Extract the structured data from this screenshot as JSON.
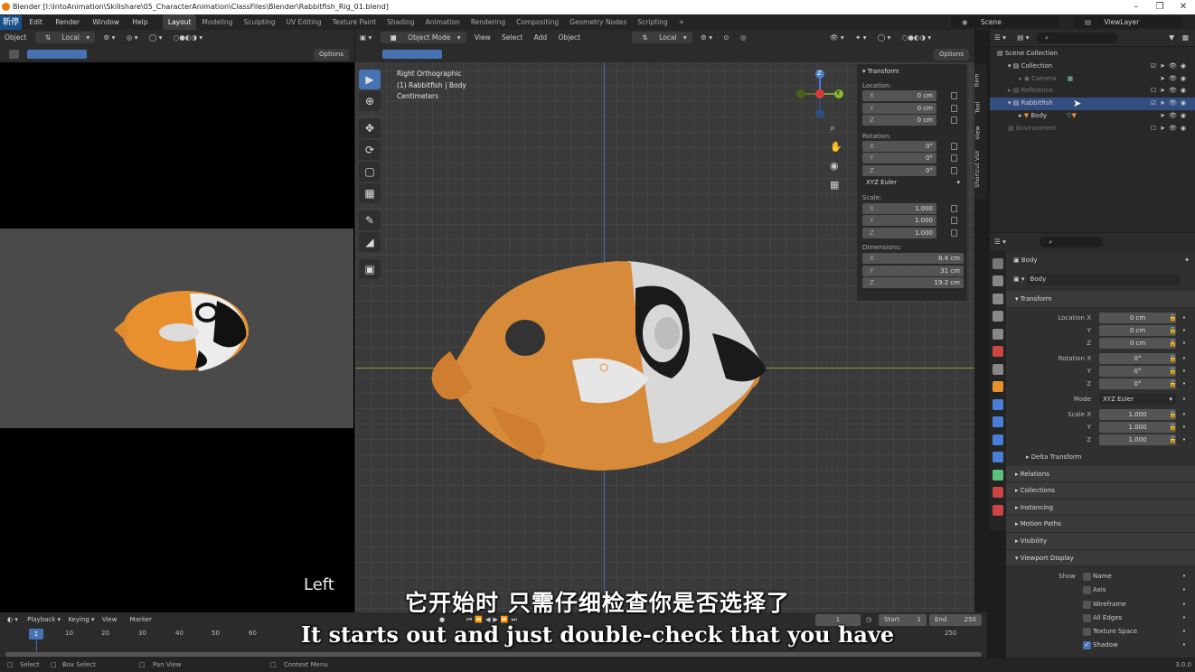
{
  "window": {
    "title": "Blender [I:\\IntoAnimation\\Skillshare\\05_CharacterAnimation\\ClassFiles\\Blender\\Rabbitfish_Rig_01.blend]",
    "watermark": "新停"
  },
  "menu": [
    "Edit",
    "Render",
    "Window",
    "Help"
  ],
  "workspaces": [
    "Layout",
    "Modeling",
    "Sculpting",
    "UV Editing",
    "Texture Paint",
    "Shading",
    "Animation",
    "Rendering",
    "Compositing",
    "Geometry Nodes",
    "Scripting",
    "+"
  ],
  "active_workspace": "Layout",
  "scene": "Scene",
  "view_layer": "ViewLayer",
  "left_header": {
    "mode": "Object",
    "orientation": "Local",
    "options": "Options"
  },
  "left_view": {
    "label": "Left"
  },
  "viewport_header": {
    "mode": "Object Mode",
    "menus": [
      "View",
      "Select",
      "Add",
      "Object"
    ],
    "orientation": "Local",
    "options": "Options"
  },
  "viewport_info": {
    "line1": "Right Orthographic",
    "line2": "(1) Rabbitfish | Body",
    "line3": "Centimeters"
  },
  "npanel": {
    "title": "Transform",
    "location_label": "Location:",
    "location": [
      {
        "axis": "X",
        "value": "0 cm"
      },
      {
        "axis": "Y",
        "value": "0 cm"
      },
      {
        "axis": "Z",
        "value": "0 cm"
      }
    ],
    "rotation_label": "Rotation:",
    "rotation": [
      {
        "axis": "X",
        "value": "0°"
      },
      {
        "axis": "Y",
        "value": "0°"
      },
      {
        "axis": "Z",
        "value": "0°"
      }
    ],
    "rotation_mode": "XYZ Euler",
    "scale_label": "Scale:",
    "scale": [
      {
        "axis": "X",
        "value": "1.000"
      },
      {
        "axis": "Y",
        "value": "1.000"
      },
      {
        "axis": "Z",
        "value": "1.000"
      }
    ],
    "dimensions_label": "Dimensions:",
    "dimensions": [
      {
        "axis": "X",
        "value": "8.4 cm"
      },
      {
        "axis": "Y",
        "value": "31 cm"
      },
      {
        "axis": "Z",
        "value": "19.2 cm"
      }
    ],
    "side_tabs": [
      "Item",
      "Tool",
      "View",
      "Shortcut VUr"
    ]
  },
  "gizmo": {
    "z": "Z",
    "y": "Y"
  },
  "outliner": {
    "rows": [
      {
        "label": "Scene Collection"
      },
      {
        "label": "Collection"
      },
      {
        "label": "Camera"
      },
      {
        "label": "Reference"
      },
      {
        "label": "Rabbitfish"
      },
      {
        "label": "Body"
      },
      {
        "label": "Environment"
      }
    ]
  },
  "properties": {
    "object_name": "Body",
    "object_field": "Body",
    "transform_title": "Transform",
    "location": [
      {
        "label": "Location X",
        "value": "0 cm"
      },
      {
        "label": "Y",
        "value": "0 cm"
      },
      {
        "label": "Z",
        "value": "0 cm"
      }
    ],
    "rotation": [
      {
        "label": "Rotation X",
        "value": "0°"
      },
      {
        "label": "Y",
        "value": "0°"
      },
      {
        "label": "Z",
        "value": "0°"
      }
    ],
    "mode_label": "Mode",
    "mode_value": "XYZ Euler",
    "scale": [
      {
        "label": "Scale X",
        "value": "1.000"
      },
      {
        "label": "Y",
        "value": "1.000"
      },
      {
        "label": "Z",
        "value": "1.000"
      }
    ],
    "delta": "Delta Transform",
    "sections": [
      "Relations",
      "Collections",
      "Instancing",
      "Motion Paths",
      "Visibility"
    ],
    "viewport_display": "Viewport Display",
    "show_label": "Show",
    "show_items": [
      {
        "label": "Name",
        "checked": false
      },
      {
        "label": "Axis",
        "checked": false
      },
      {
        "label": "Wireframe",
        "checked": false
      },
      {
        "label": "All Edges",
        "checked": false
      },
      {
        "label": "Texture Space",
        "checked": false
      },
      {
        "label": "Shadow",
        "checked": true
      }
    ]
  },
  "timeline": {
    "menus": [
      "Playback",
      "Keying",
      "View",
      "Marker"
    ],
    "current_frame": "1",
    "start_label": "Start",
    "start": "1",
    "end_label": "End",
    "end": "250",
    "ticks": [
      "1",
      "10",
      "20",
      "30",
      "40",
      "50",
      "60",
      "250"
    ]
  },
  "statusbar": {
    "select": "Select",
    "box_select": "Box Select",
    "pan_view": "Pan View",
    "context_menu": "Context Menu",
    "version": "3.0.0"
  },
  "subtitles": {
    "cn": "它开始时 只需仔细检查你是否选择了",
    "en": "It starts out and just double-check that you have"
  }
}
